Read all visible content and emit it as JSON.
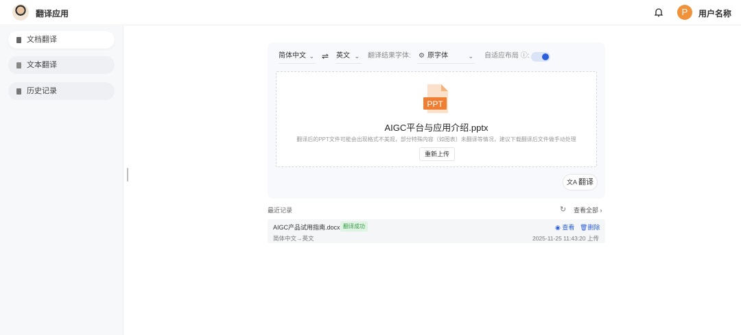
{
  "header": {
    "app_title": "翻译应用",
    "user_name": "用户名称",
    "user_initial": "P"
  },
  "sidebar": {
    "items": [
      {
        "label": "文档翻译"
      },
      {
        "label": "文本翻译"
      },
      {
        "label": "历史记录"
      }
    ]
  },
  "toolbar": {
    "source_lang": "简体中文",
    "swap": "⇌",
    "target_lang": "英文",
    "font_label": "翻译结果字体:",
    "font_value": "原字体",
    "adaptive_label": "自适应布局",
    "adaptive_on": true
  },
  "upload": {
    "file_icon_text": "PPT",
    "file_name": "AIGC平台与应用介绍.pptx",
    "hint": "翻译后的PPT文件可能会出现格式不美观，部分特殊内容（如图表）未翻译等情况，建议下载翻译后文件做手动处理",
    "reupload_label": "重新上传",
    "translate_label": "翻译"
  },
  "recent": {
    "title": "最近记录",
    "view_all": "查看全部",
    "records": [
      {
        "name": "AIGC产品试用指南.docx",
        "status": "翻译成功",
        "langs": "简体中文→英文",
        "view": "查看",
        "delete": "删除",
        "time": "2025-11-25 11:43:20 上传"
      }
    ]
  },
  "colors": {
    "accent": "#2b5fd9",
    "ppt": "#ef7d32",
    "success": "#3a9a4b"
  }
}
